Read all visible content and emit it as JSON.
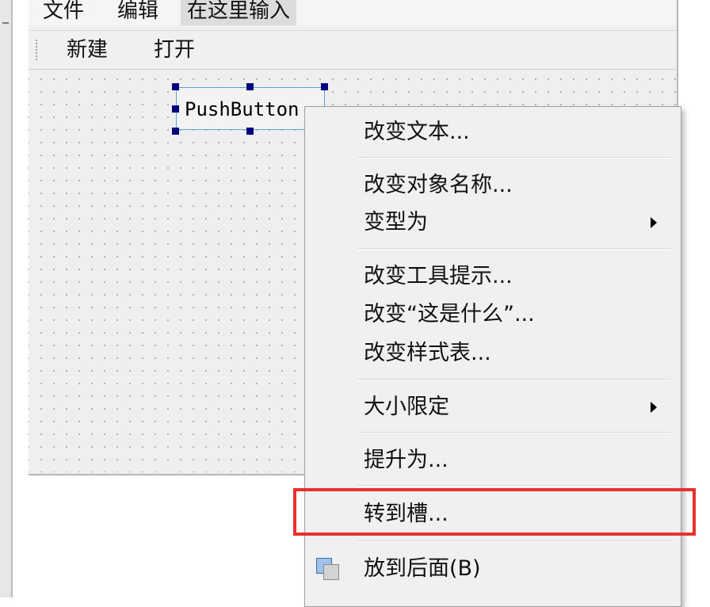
{
  "menubar": {
    "file": "文件",
    "edit": "编辑",
    "type_here": "在这里输入"
  },
  "toolbar": {
    "new": "新建",
    "open": "打开"
  },
  "widget": {
    "pushbutton_text": "PushButton"
  },
  "context_menu": {
    "items": [
      {
        "label": "改变文本..."
      },
      {
        "label": "改变对象名称..."
      },
      {
        "label": "变型为",
        "submenu": true
      },
      {
        "label": "改变工具提示..."
      },
      {
        "label": "改变“这是什么”..."
      },
      {
        "label": "改变样式表..."
      },
      {
        "label": "大小限定",
        "submenu": true
      },
      {
        "label": "提升为..."
      },
      {
        "label": "转到槽..."
      },
      {
        "label": "放到后面(B)",
        "icon": "send-to-back-icon"
      }
    ]
  },
  "highlight": {
    "target": "转到槽...",
    "color": "#e8312d"
  }
}
